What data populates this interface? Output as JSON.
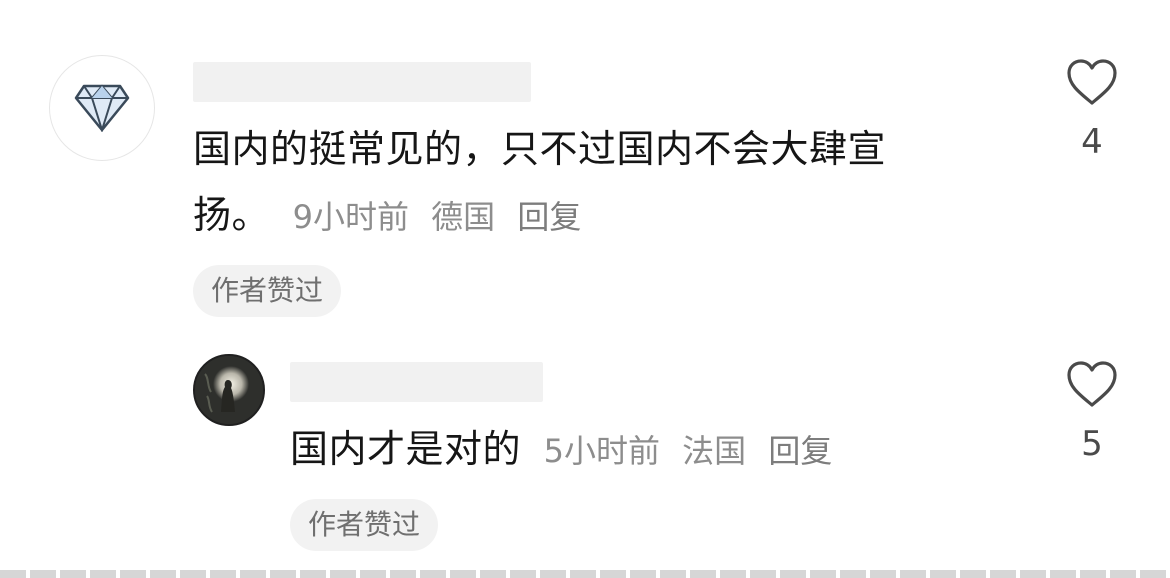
{
  "comments": [
    {
      "text": "国内的挺常见的，只不过国内不会大肆宣扬。",
      "text_line1": "国内的挺常见的，只不过国内不会大肆宣",
      "text_line2": "扬。",
      "time": "9小时前",
      "location": "德国",
      "reply_label": "回复",
      "author_liked_badge": "作者赞过",
      "like_count": "4",
      "avatar_icon": "diamond-icon"
    },
    {
      "text": "国内才是对的",
      "time": "5小时前",
      "location": "法国",
      "reply_label": "回复",
      "author_liked_badge": "作者赞过",
      "like_count": "5",
      "avatar_icon": "silhouette-photo"
    }
  ],
  "colors": {
    "text_primary": "#161616",
    "text_meta": "#8d8d8d",
    "badge_bg": "#f2f2f2",
    "heart_stroke": "#4a4a4a"
  }
}
